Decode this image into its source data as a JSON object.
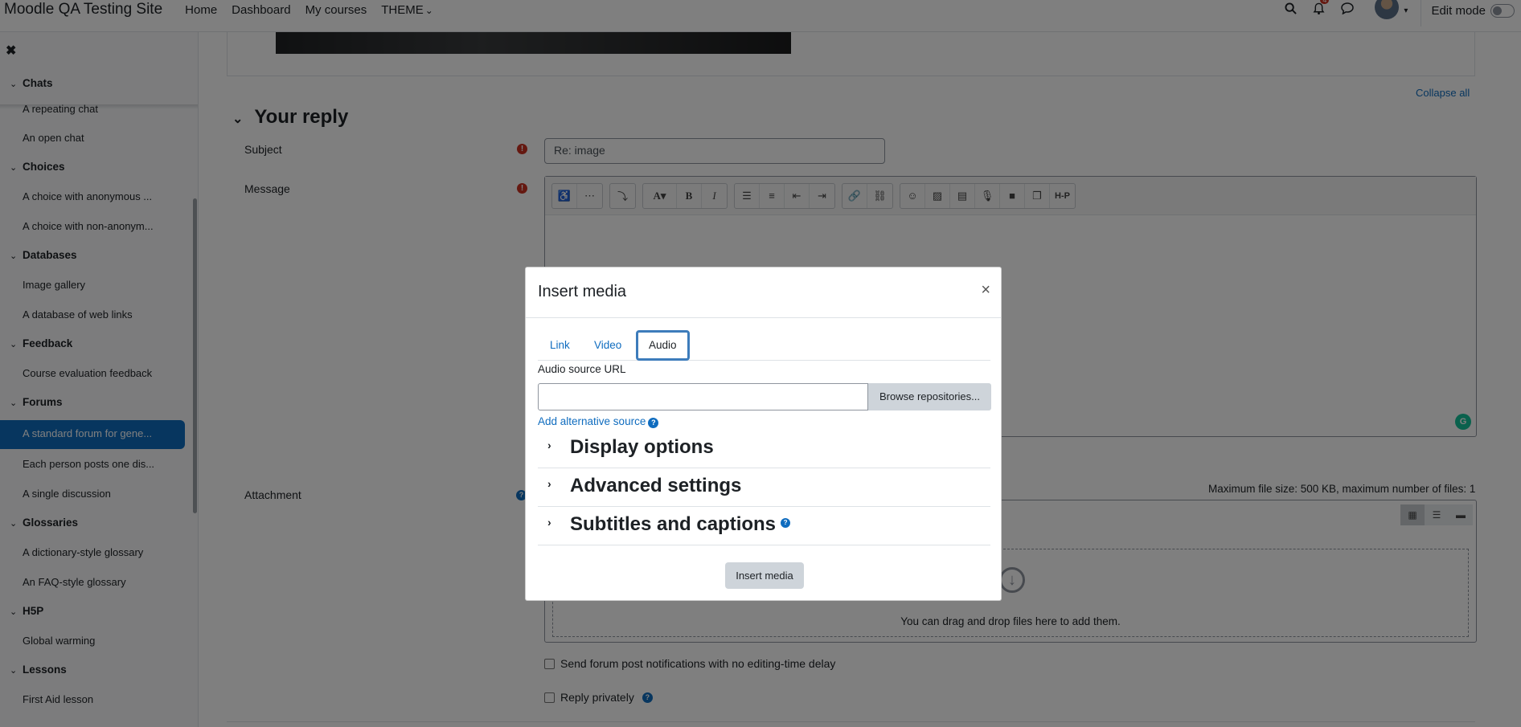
{
  "navbar": {
    "site_name": "Moodle QA Testing Site",
    "links": [
      "Home",
      "Dashboard",
      "My courses",
      "THEME"
    ],
    "theme_caret": "⌄",
    "notification_count": "4",
    "edit_mode_label": "Edit mode"
  },
  "drawer": {
    "close_glyph": "✖",
    "sections": [
      {
        "title": "Chats",
        "items": [
          "A repeating chat",
          "An open chat"
        ]
      },
      {
        "title": "Choices",
        "items": [
          "A choice with anonymous ...",
          "A choice with non-anonym..."
        ]
      },
      {
        "title": "Databases",
        "items": [
          "Image gallery",
          "A database of web links"
        ]
      },
      {
        "title": "Feedback",
        "items": [
          "Course evaluation feedback"
        ]
      },
      {
        "title": "Forums",
        "items": [
          "A standard forum for gene...",
          "Each person posts one dis...",
          "A single discussion"
        ]
      },
      {
        "title": "Glossaries",
        "items": [
          "A dictionary-style glossary",
          "An FAQ-style glossary"
        ]
      },
      {
        "title": "H5P",
        "items": [
          "Global warming"
        ]
      },
      {
        "title": "Lessons",
        "items": [
          "First Aid lesson"
        ]
      }
    ],
    "active_item": "A standard forum for gene..."
  },
  "main": {
    "collapse_all": "Collapse all",
    "section_title": "Your reply",
    "subject_label": "Subject",
    "subject_value": "Re: image",
    "message_label": "Message",
    "attachment_label": "Attachment",
    "max_file_size": "Maximum file size: 500 KB, maximum number of files: 1",
    "drop_text": "You can drag and drop files here to add them.",
    "notify_checkbox": "Send forum post notifications with no editing-time delay",
    "private_checkbox": "Reply privately"
  },
  "modal": {
    "title": "Insert media",
    "close_glyph": "×",
    "tabs": [
      "Link",
      "Video",
      "Audio"
    ],
    "active_tab": "Audio",
    "source_url_label": "Audio source URL",
    "source_url_value": "",
    "browse_button": "Browse repositories...",
    "add_alt_source": "Add alternative source",
    "sections": [
      "Display options",
      "Advanced settings",
      "Subtitles and captions"
    ],
    "insert_button": "Insert media"
  },
  "colors": {
    "accent": "#0f6cbf",
    "required": "#ca3120",
    "backdrop": "rgba(0,0,0,0.5)"
  }
}
